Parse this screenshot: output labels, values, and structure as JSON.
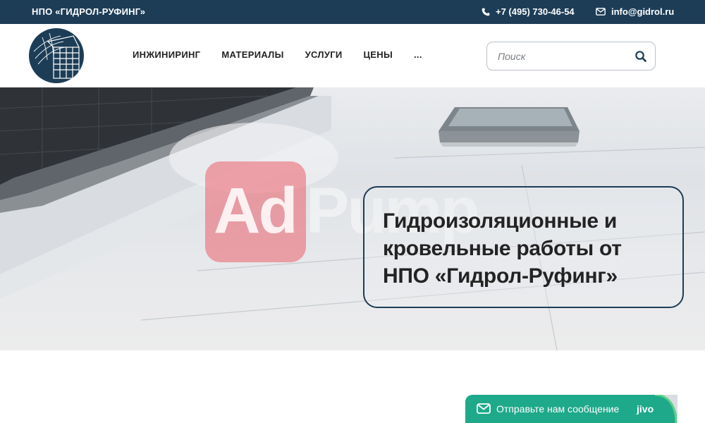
{
  "topbar": {
    "brand": "НПО «ГИДРОЛ-РУФИНГ»",
    "phone": "+7 (495) 730-46-54",
    "email": "info@gidrol.ru",
    "background": "#1d3d57"
  },
  "nav": {
    "items": [
      "ИНЖИНИРИНГ",
      "МАТЕРИАЛЫ",
      "УСЛУГИ",
      "ЦЕНЫ",
      "..."
    ]
  },
  "search": {
    "placeholder": "Поиск",
    "value": ""
  },
  "hero": {
    "watermark_ad": "Ad",
    "watermark_pump": "Pump",
    "headline": "Гидроизоляционные и кровельные работы от НПО «Гидрол-Руфинг»",
    "accent": "#1d3d57"
  },
  "chat": {
    "label": "Отправьте нам сообщение",
    "brand": "jivo",
    "background": "#1ea98a"
  },
  "icons": [
    "phone-icon",
    "envelope-icon",
    "search-icon",
    "logo-globe-icon",
    "chat-envelope-icon"
  ]
}
